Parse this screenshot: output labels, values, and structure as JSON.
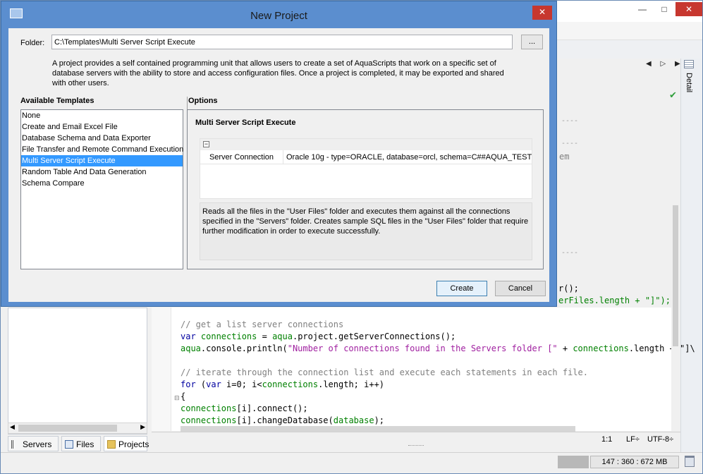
{
  "background_window": {
    "minimize": "—",
    "maximize": "□",
    "close": "✕",
    "detail_tab": "Detail",
    "nav_arrows": "◀ ▷ ▶",
    "left_tabs": [
      "Servers",
      "Files",
      "Projects"
    ],
    "code_lines": [
      {
        "parts": [
          [
            "c-com",
            "// get a list server connections"
          ]
        ]
      },
      {
        "parts": [
          [
            "c-kw",
            "var "
          ],
          [
            "c-id",
            "connections"
          ],
          [
            "c-pl",
            " = "
          ],
          [
            "c-id",
            "aqua"
          ],
          [
            "c-pl",
            ".project.getServerConnections();"
          ]
        ]
      },
      {
        "parts": [
          [
            "c-id",
            "aqua"
          ],
          [
            "c-pl",
            ".console.println("
          ],
          [
            "c-str",
            "\"Number of connections found in the Servers folder [\""
          ],
          [
            "c-pl",
            " + "
          ],
          [
            "c-id",
            "connections"
          ],
          [
            "c-pl",
            ".length + \"]\\"
          ]
        ]
      },
      {
        "parts": [
          [
            "c-pl",
            ""
          ]
        ]
      },
      {
        "parts": [
          [
            "c-com",
            "// iterate through the connection list and execute each statements in each file."
          ]
        ]
      },
      {
        "parts": [
          [
            "c-kw",
            "for "
          ],
          [
            "c-pl",
            "("
          ],
          [
            "c-kw",
            "var "
          ],
          [
            "c-pl",
            "i=0; i<"
          ],
          [
            "c-id",
            "connections"
          ],
          [
            "c-pl",
            ".length; i++)"
          ]
        ]
      },
      {
        "parts": [
          [
            "c-pl",
            "{"
          ]
        ]
      },
      {
        "parts": [
          [
            "c-id",
            "connections"
          ],
          [
            "c-pl",
            "[i].connect();"
          ]
        ]
      },
      {
        "parts": [
          [
            "c-id",
            "connections"
          ],
          [
            "c-pl",
            "[i].changeDatabase("
          ],
          [
            "c-id",
            "database"
          ],
          [
            "c-pl",
            ");"
          ]
        ]
      }
    ],
    "code_fragment_1": "r();",
    "code_fragment_2": "erFiles.length + \"]\");",
    "code_fragment_3": "em",
    "fold_mark": "⊟",
    "status": {
      "cursor": "1:1",
      "line_ending": "LF÷",
      "encoding": "UTF-8÷",
      "memory": "147 : 360 : 672 MB"
    }
  },
  "dialog": {
    "title": "New Project",
    "close": "✕",
    "folder_label": "Folder:",
    "folder_value": "C:\\Templates\\Multi Server Script Execute",
    "browse_label": "...",
    "description": "A project provides a self contained programming unit that allows users to create a set of AquaScripts that work on a specific set of database servers with the ability to store and access configuration files.  Once a project is completed, it may be exported and shared with other users.",
    "templates_heading": "Available Templates",
    "templates": [
      "None",
      "Create and Email Excel File",
      "Database Schema and Data Exporter",
      "File Transfer and Remote Command Execution",
      "Multi Server Script Execute",
      "Random Table And Data Generation",
      "Schema Compare"
    ],
    "selected_template_index": 4,
    "options_heading": "Options",
    "option_title": "Multi Server Script Execute",
    "collapse_symbol": "−",
    "property": {
      "key": "Server Connection",
      "value": "Oracle 10g - type=ORACLE, database=orcl, schema=C##AQUA_TEST"
    },
    "option_description": "Reads all the files in the \"User Files\" folder and executes them against all the connections specified in the \"Servers\" folder. Creates sample SQL files in the \"User Files\" folder that require further modification in order to execute successfully.",
    "create_label": "Create",
    "cancel_label": "Cancel"
  }
}
